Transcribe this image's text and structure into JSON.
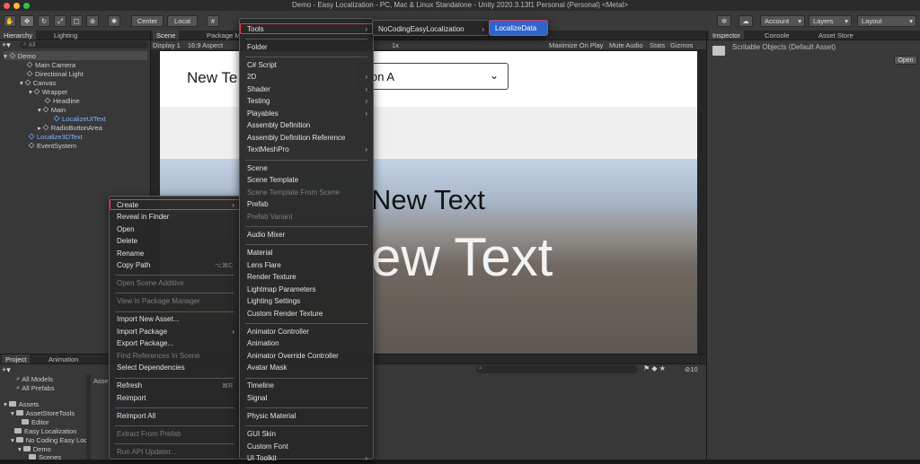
{
  "window": {
    "title": "Demo - Easy Localization - PC, Mac & Linux Standalone - Unity 2020.3.13f1 Personal (Personal) <Metal>"
  },
  "toolbar": {
    "center_label": "Center",
    "local_label": "Local",
    "account_label": "Account",
    "layers_label": "Layers",
    "layout_label": "Layout"
  },
  "hierarchy": {
    "tab_label": "Hierarchy",
    "lighting_tab": "Lighting",
    "search_placeholder": "All",
    "items": [
      "Demo",
      "Main Camera",
      "Directional Light",
      "Canvas",
      "Wrapper",
      "Headline",
      "Main",
      "LocalizeUIText",
      "RadioButtonArea",
      "Localize3DText",
      "EventSystem"
    ]
  },
  "scene_tabs": {
    "scene": "Scene",
    "package": "Package M"
  },
  "game_bar": {
    "display": "Display 1",
    "aspect": "16:9 Aspect",
    "scale": "1x",
    "maximize": "Maximize On Play",
    "mute": "Mute Audio",
    "stats": "Stats",
    "gizmos": "Gizmos"
  },
  "game_view": {
    "header_text": "New Te",
    "dropdown_text": "on A",
    "text_small": "New Text",
    "text_large": "ew Text"
  },
  "menubar": {
    "tools": "Tools",
    "nocoding": "NoCodingEasyLocalization",
    "localizedata": "LocalizeData"
  },
  "inspector": {
    "tab": "Inspector",
    "console_tab": "Console",
    "asset_store_tab": "Asset Store",
    "object_title": "Scritable Objects (Default Asset)",
    "open_button": "Open"
  },
  "project": {
    "tab": "Project",
    "animation_tab": "Animation",
    "favorites": [
      "All Models",
      "All Prefabs"
    ],
    "assets_root": "Assets",
    "tree": [
      "AssetStoreTools",
      "Editor",
      "Easy Localization",
      "No Coding Easy Loc",
      "Demo",
      "Scenes"
    ],
    "breadcrumb": "Asse",
    "hidden_count": "10"
  },
  "context_menu": {
    "items": [
      {
        "label": "Create",
        "arrow": true,
        "highlight": true
      },
      {
        "label": "Reveal in Finder"
      },
      {
        "label": "Open"
      },
      {
        "label": "Delete"
      },
      {
        "label": "Rename"
      },
      {
        "label": "Copy Path",
        "shortcut": "⌥⌘C"
      },
      {
        "sep": true
      },
      {
        "label": "Open Scene Additive",
        "disabled": true
      },
      {
        "sep": true
      },
      {
        "label": "View in Package Manager",
        "disabled": true
      },
      {
        "sep": true
      },
      {
        "label": "Import New Asset..."
      },
      {
        "label": "Import Package",
        "arrow": true
      },
      {
        "label": "Export Package..."
      },
      {
        "label": "Find References In Scene",
        "disabled": true
      },
      {
        "label": "Select Dependencies"
      },
      {
        "sep": true
      },
      {
        "label": "Refresh",
        "shortcut": "⌘R"
      },
      {
        "label": "Reimport"
      },
      {
        "sep": true
      },
      {
        "label": "Reimport All"
      },
      {
        "sep": true
      },
      {
        "label": "Extract From Prefab",
        "disabled": true
      },
      {
        "sep": true
      },
      {
        "label": "Run API Updater...",
        "disabled": true
      }
    ]
  },
  "create_menu": {
    "items": [
      {
        "label": "Tools",
        "arrow": true,
        "highlight": true
      },
      {
        "sep": true
      },
      {
        "label": "Folder"
      },
      {
        "sep": true
      },
      {
        "label": "C# Script"
      },
      {
        "label": "2D",
        "arrow": true
      },
      {
        "label": "Shader",
        "arrow": true
      },
      {
        "label": "Testing",
        "arrow": true
      },
      {
        "label": "Playables",
        "arrow": true
      },
      {
        "label": "Assembly Definition"
      },
      {
        "label": "Assembly Definition Reference"
      },
      {
        "label": "TextMeshPro",
        "arrow": true
      },
      {
        "sep": true
      },
      {
        "label": "Scene"
      },
      {
        "label": "Scene Template"
      },
      {
        "label": "Scene Template From Scene",
        "disabled": true
      },
      {
        "label": "Prefab"
      },
      {
        "label": "Prefab Variant",
        "disabled": true
      },
      {
        "sep": true
      },
      {
        "label": "Audio Mixer"
      },
      {
        "sep": true
      },
      {
        "label": "Material"
      },
      {
        "label": "Lens Flare"
      },
      {
        "label": "Render Texture"
      },
      {
        "label": "Lightmap Parameters"
      },
      {
        "label": "Lighting Settings"
      },
      {
        "label": "Custom Render Texture"
      },
      {
        "sep": true
      },
      {
        "label": "Animator Controller"
      },
      {
        "label": "Animation"
      },
      {
        "label": "Animator Override Controller"
      },
      {
        "label": "Avatar Mask"
      },
      {
        "sep": true
      },
      {
        "label": "Timeline"
      },
      {
        "label": "Signal"
      },
      {
        "sep": true
      },
      {
        "label": "Physic Material"
      },
      {
        "sep": true
      },
      {
        "label": "GUI Skin"
      },
      {
        "label": "Custom Font"
      },
      {
        "label": "UI Toolkit",
        "arrow": true
      }
    ]
  },
  "colors": {
    "highlight": "#e8384f",
    "selection": "#2f65ca",
    "link_blue": "#58a6ff"
  }
}
